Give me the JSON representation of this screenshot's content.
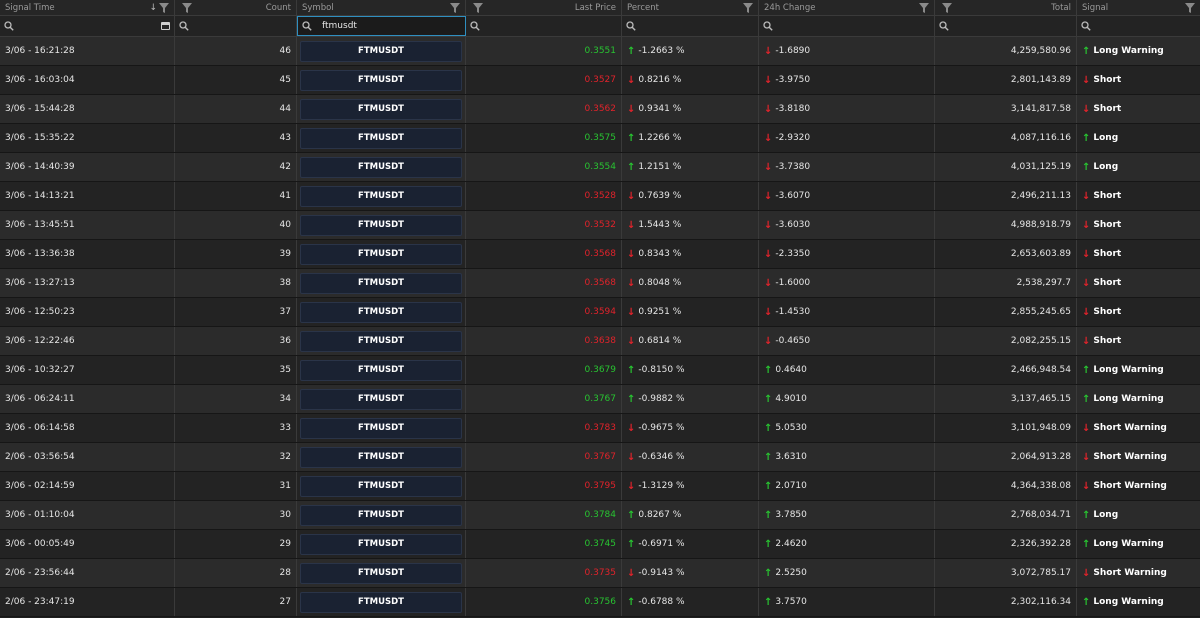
{
  "columns": [
    {
      "key": "signal_time",
      "label": "Signal Time",
      "align": "left"
    },
    {
      "key": "count",
      "label": "Count",
      "align": "right"
    },
    {
      "key": "symbol",
      "label": "Symbol",
      "align": "left"
    },
    {
      "key": "last_price",
      "label": "Last Price",
      "align": "right"
    },
    {
      "key": "percent",
      "label": "Percent",
      "align": "left"
    },
    {
      "key": "change_24h",
      "label": "24h Change",
      "align": "left"
    },
    {
      "key": "total",
      "label": "Total",
      "align": "right"
    },
    {
      "key": "signal",
      "label": "Signal",
      "align": "left"
    }
  ],
  "filters": {
    "symbol_value": "ftmusdt"
  },
  "colors": {
    "up": "#28c331",
    "down": "#e0232b",
    "focus": "#2f8fc0"
  },
  "rows": [
    {
      "time": "3/06 - 16:21:28",
      "count": "46",
      "symbol": "FTMUSDT",
      "price": "0.3551",
      "price_dir": "up",
      "percent": "-1.2663 %",
      "percent_dir": "up",
      "change": "-1.6890",
      "change_dir": "down",
      "total": "4,259,580.96",
      "signal": "Long Warning",
      "signal_dir": "up"
    },
    {
      "time": "3/06 - 16:03:04",
      "count": "45",
      "symbol": "FTMUSDT",
      "price": "0.3527",
      "price_dir": "down",
      "percent": "0.8216 %",
      "percent_dir": "down",
      "change": "-3.9750",
      "change_dir": "down",
      "total": "2,801,143.89",
      "signal": "Short",
      "signal_dir": "down"
    },
    {
      "time": "3/06 - 15:44:28",
      "count": "44",
      "symbol": "FTMUSDT",
      "price": "0.3562",
      "price_dir": "down",
      "percent": "0.9341 %",
      "percent_dir": "down",
      "change": "-3.8180",
      "change_dir": "down",
      "total": "3,141,817.58",
      "signal": "Short",
      "signal_dir": "down"
    },
    {
      "time": "3/06 - 15:35:22",
      "count": "43",
      "symbol": "FTMUSDT",
      "price": "0.3575",
      "price_dir": "up",
      "percent": "1.2266 %",
      "percent_dir": "up",
      "change": "-2.9320",
      "change_dir": "down",
      "total": "4,087,116.16",
      "signal": "Long",
      "signal_dir": "up"
    },
    {
      "time": "3/06 - 14:40:39",
      "count": "42",
      "symbol": "FTMUSDT",
      "price": "0.3554",
      "price_dir": "up",
      "percent": "1.2151 %",
      "percent_dir": "up",
      "change": "-3.7380",
      "change_dir": "down",
      "total": "4,031,125.19",
      "signal": "Long",
      "signal_dir": "up"
    },
    {
      "time": "3/06 - 14:13:21",
      "count": "41",
      "symbol": "FTMUSDT",
      "price": "0.3528",
      "price_dir": "down",
      "percent": "0.7639 %",
      "percent_dir": "down",
      "change": "-3.6070",
      "change_dir": "down",
      "total": "2,496,211.13",
      "signal": "Short",
      "signal_dir": "down"
    },
    {
      "time": "3/06 - 13:45:51",
      "count": "40",
      "symbol": "FTMUSDT",
      "price": "0.3532",
      "price_dir": "down",
      "percent": "1.5443 %",
      "percent_dir": "down",
      "change": "-3.6030",
      "change_dir": "down",
      "total": "4,988,918.79",
      "signal": "Short",
      "signal_dir": "down"
    },
    {
      "time": "3/06 - 13:36:38",
      "count": "39",
      "symbol": "FTMUSDT",
      "price": "0.3568",
      "price_dir": "down",
      "percent": "0.8343 %",
      "percent_dir": "down",
      "change": "-2.3350",
      "change_dir": "down",
      "total": "2,653,603.89",
      "signal": "Short",
      "signal_dir": "down"
    },
    {
      "time": "3/06 - 13:27:13",
      "count": "38",
      "symbol": "FTMUSDT",
      "price": "0.3568",
      "price_dir": "down",
      "percent": "0.8048 %",
      "percent_dir": "down",
      "change": "-1.6000",
      "change_dir": "down",
      "total": "2,538,297.7",
      "signal": "Short",
      "signal_dir": "down"
    },
    {
      "time": "3/06 - 12:50:23",
      "count": "37",
      "symbol": "FTMUSDT",
      "price": "0.3594",
      "price_dir": "down",
      "percent": "0.9251 %",
      "percent_dir": "down",
      "change": "-1.4530",
      "change_dir": "down",
      "total": "2,855,245.65",
      "signal": "Short",
      "signal_dir": "down"
    },
    {
      "time": "3/06 - 12:22:46",
      "count": "36",
      "symbol": "FTMUSDT",
      "price": "0.3638",
      "price_dir": "down",
      "percent": "0.6814 %",
      "percent_dir": "down",
      "change": "-0.4650",
      "change_dir": "down",
      "total": "2,082,255.15",
      "signal": "Short",
      "signal_dir": "down"
    },
    {
      "time": "3/06 - 10:32:27",
      "count": "35",
      "symbol": "FTMUSDT",
      "price": "0.3679",
      "price_dir": "up",
      "percent": "-0.8150 %",
      "percent_dir": "up",
      "change": "0.4640",
      "change_dir": "up",
      "total": "2,466,948.54",
      "signal": "Long Warning",
      "signal_dir": "up"
    },
    {
      "time": "3/06 - 06:24:11",
      "count": "34",
      "symbol": "FTMUSDT",
      "price": "0.3767",
      "price_dir": "up",
      "percent": "-0.9882 %",
      "percent_dir": "up",
      "change": "4.9010",
      "change_dir": "up",
      "total": "3,137,465.15",
      "signal": "Long Warning",
      "signal_dir": "up"
    },
    {
      "time": "3/06 - 06:14:58",
      "count": "33",
      "symbol": "FTMUSDT",
      "price": "0.3783",
      "price_dir": "down",
      "percent": "-0.9675 %",
      "percent_dir": "down",
      "change": "5.0530",
      "change_dir": "up",
      "total": "3,101,948.09",
      "signal": "Short Warning",
      "signal_dir": "down"
    },
    {
      "time": "2/06 - 03:56:54",
      "count": "32",
      "symbol": "FTMUSDT",
      "price": "0.3767",
      "price_dir": "down",
      "percent": "-0.6346 %",
      "percent_dir": "down",
      "change": "3.6310",
      "change_dir": "up",
      "total": "2,064,913.28",
      "signal": "Short Warning",
      "signal_dir": "down"
    },
    {
      "time": "3/06 - 02:14:59",
      "count": "31",
      "symbol": "FTMUSDT",
      "price": "0.3795",
      "price_dir": "down",
      "percent": "-1.3129 %",
      "percent_dir": "down",
      "change": "2.0710",
      "change_dir": "up",
      "total": "4,364,338.08",
      "signal": "Short Warning",
      "signal_dir": "down"
    },
    {
      "time": "3/06 - 01:10:04",
      "count": "30",
      "symbol": "FTMUSDT",
      "price": "0.3784",
      "price_dir": "up",
      "percent": "0.8267 %",
      "percent_dir": "up",
      "change": "3.7850",
      "change_dir": "up",
      "total": "2,768,034.71",
      "signal": "Long",
      "signal_dir": "up"
    },
    {
      "time": "3/06 - 00:05:49",
      "count": "29",
      "symbol": "FTMUSDT",
      "price": "0.3745",
      "price_dir": "up",
      "percent": "-0.6971 %",
      "percent_dir": "up",
      "change": "2.4620",
      "change_dir": "up",
      "total": "2,326,392.28",
      "signal": "Long Warning",
      "signal_dir": "up"
    },
    {
      "time": "2/06 - 23:56:44",
      "count": "28",
      "symbol": "FTMUSDT",
      "price": "0.3735",
      "price_dir": "down",
      "percent": "-0.9143 %",
      "percent_dir": "down",
      "change": "2.5250",
      "change_dir": "up",
      "total": "3,072,785.17",
      "signal": "Short Warning",
      "signal_dir": "down"
    },
    {
      "time": "2/06 - 23:47:19",
      "count": "27",
      "symbol": "FTMUSDT",
      "price": "0.3756",
      "price_dir": "up",
      "percent": "-0.6788 %",
      "percent_dir": "up",
      "change": "3.7570",
      "change_dir": "up",
      "total": "2,302,116.34",
      "signal": "Long Warning",
      "signal_dir": "up"
    }
  ]
}
